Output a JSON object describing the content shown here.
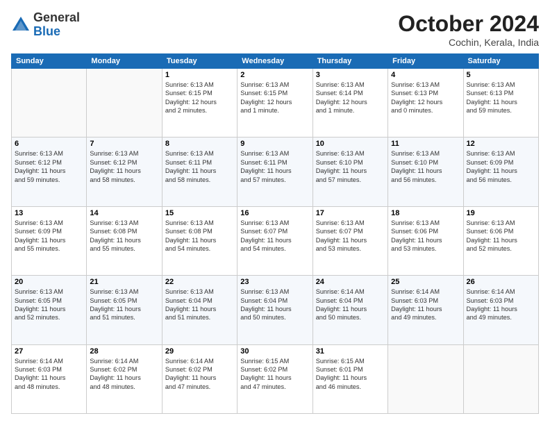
{
  "header": {
    "logo_general": "General",
    "logo_blue": "Blue",
    "month_title": "October 2024",
    "location": "Cochin, Kerala, India"
  },
  "days_of_week": [
    "Sunday",
    "Monday",
    "Tuesday",
    "Wednesday",
    "Thursday",
    "Friday",
    "Saturday"
  ],
  "weeks": [
    [
      {
        "day": "",
        "info": ""
      },
      {
        "day": "",
        "info": ""
      },
      {
        "day": "1",
        "info": "Sunrise: 6:13 AM\nSunset: 6:15 PM\nDaylight: 12 hours\nand 2 minutes."
      },
      {
        "day": "2",
        "info": "Sunrise: 6:13 AM\nSunset: 6:15 PM\nDaylight: 12 hours\nand 1 minute."
      },
      {
        "day": "3",
        "info": "Sunrise: 6:13 AM\nSunset: 6:14 PM\nDaylight: 12 hours\nand 1 minute."
      },
      {
        "day": "4",
        "info": "Sunrise: 6:13 AM\nSunset: 6:13 PM\nDaylight: 12 hours\nand 0 minutes."
      },
      {
        "day": "5",
        "info": "Sunrise: 6:13 AM\nSunset: 6:13 PM\nDaylight: 11 hours\nand 59 minutes."
      }
    ],
    [
      {
        "day": "6",
        "info": "Sunrise: 6:13 AM\nSunset: 6:12 PM\nDaylight: 11 hours\nand 59 minutes."
      },
      {
        "day": "7",
        "info": "Sunrise: 6:13 AM\nSunset: 6:12 PM\nDaylight: 11 hours\nand 58 minutes."
      },
      {
        "day": "8",
        "info": "Sunrise: 6:13 AM\nSunset: 6:11 PM\nDaylight: 11 hours\nand 58 minutes."
      },
      {
        "day": "9",
        "info": "Sunrise: 6:13 AM\nSunset: 6:11 PM\nDaylight: 11 hours\nand 57 minutes."
      },
      {
        "day": "10",
        "info": "Sunrise: 6:13 AM\nSunset: 6:10 PM\nDaylight: 11 hours\nand 57 minutes."
      },
      {
        "day": "11",
        "info": "Sunrise: 6:13 AM\nSunset: 6:10 PM\nDaylight: 11 hours\nand 56 minutes."
      },
      {
        "day": "12",
        "info": "Sunrise: 6:13 AM\nSunset: 6:09 PM\nDaylight: 11 hours\nand 56 minutes."
      }
    ],
    [
      {
        "day": "13",
        "info": "Sunrise: 6:13 AM\nSunset: 6:09 PM\nDaylight: 11 hours\nand 55 minutes."
      },
      {
        "day": "14",
        "info": "Sunrise: 6:13 AM\nSunset: 6:08 PM\nDaylight: 11 hours\nand 55 minutes."
      },
      {
        "day": "15",
        "info": "Sunrise: 6:13 AM\nSunset: 6:08 PM\nDaylight: 11 hours\nand 54 minutes."
      },
      {
        "day": "16",
        "info": "Sunrise: 6:13 AM\nSunset: 6:07 PM\nDaylight: 11 hours\nand 54 minutes."
      },
      {
        "day": "17",
        "info": "Sunrise: 6:13 AM\nSunset: 6:07 PM\nDaylight: 11 hours\nand 53 minutes."
      },
      {
        "day": "18",
        "info": "Sunrise: 6:13 AM\nSunset: 6:06 PM\nDaylight: 11 hours\nand 53 minutes."
      },
      {
        "day": "19",
        "info": "Sunrise: 6:13 AM\nSunset: 6:06 PM\nDaylight: 11 hours\nand 52 minutes."
      }
    ],
    [
      {
        "day": "20",
        "info": "Sunrise: 6:13 AM\nSunset: 6:05 PM\nDaylight: 11 hours\nand 52 minutes."
      },
      {
        "day": "21",
        "info": "Sunrise: 6:13 AM\nSunset: 6:05 PM\nDaylight: 11 hours\nand 51 minutes."
      },
      {
        "day": "22",
        "info": "Sunrise: 6:13 AM\nSunset: 6:04 PM\nDaylight: 11 hours\nand 51 minutes."
      },
      {
        "day": "23",
        "info": "Sunrise: 6:13 AM\nSunset: 6:04 PM\nDaylight: 11 hours\nand 50 minutes."
      },
      {
        "day": "24",
        "info": "Sunrise: 6:14 AM\nSunset: 6:04 PM\nDaylight: 11 hours\nand 50 minutes."
      },
      {
        "day": "25",
        "info": "Sunrise: 6:14 AM\nSunset: 6:03 PM\nDaylight: 11 hours\nand 49 minutes."
      },
      {
        "day": "26",
        "info": "Sunrise: 6:14 AM\nSunset: 6:03 PM\nDaylight: 11 hours\nand 49 minutes."
      }
    ],
    [
      {
        "day": "27",
        "info": "Sunrise: 6:14 AM\nSunset: 6:03 PM\nDaylight: 11 hours\nand 48 minutes."
      },
      {
        "day": "28",
        "info": "Sunrise: 6:14 AM\nSunset: 6:02 PM\nDaylight: 11 hours\nand 48 minutes."
      },
      {
        "day": "29",
        "info": "Sunrise: 6:14 AM\nSunset: 6:02 PM\nDaylight: 11 hours\nand 47 minutes."
      },
      {
        "day": "30",
        "info": "Sunrise: 6:15 AM\nSunset: 6:02 PM\nDaylight: 11 hours\nand 47 minutes."
      },
      {
        "day": "31",
        "info": "Sunrise: 6:15 AM\nSunset: 6:01 PM\nDaylight: 11 hours\nand 46 minutes."
      },
      {
        "day": "",
        "info": ""
      },
      {
        "day": "",
        "info": ""
      }
    ]
  ]
}
